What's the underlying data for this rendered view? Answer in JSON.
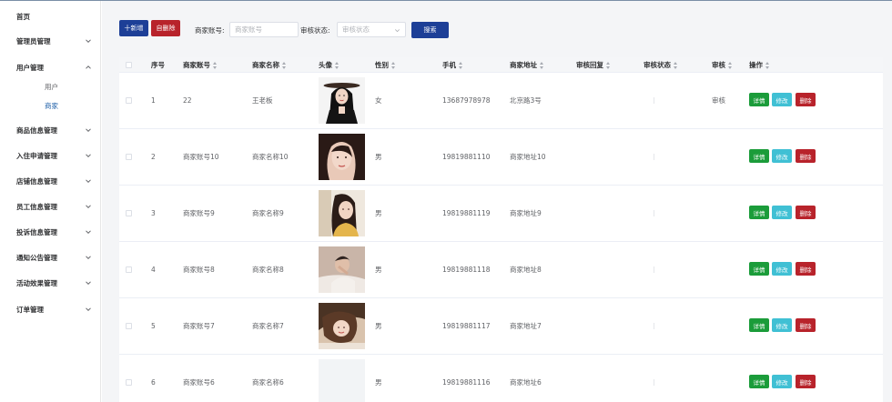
{
  "sidebar": {
    "items": [
      {
        "label": "首页"
      },
      {
        "label": "管理员管理"
      },
      {
        "label": "用户管理"
      },
      {
        "label": "商品信息管理"
      },
      {
        "label": "入住申请管理"
      },
      {
        "label": "店铺信息管理"
      },
      {
        "label": "员工信息管理"
      },
      {
        "label": "投诉信息管理"
      },
      {
        "label": "通知公告管理"
      },
      {
        "label": "活动效果管理"
      },
      {
        "label": "订单管理"
      }
    ],
    "sub_items": [
      {
        "label": "用户"
      },
      {
        "label": "商家"
      }
    ],
    "active_color": "#1f5fa8"
  },
  "toolbar": {
    "add_label": "十新增",
    "delete_label": "自删除",
    "account_label": "商家账号:",
    "account_placeholder": "商家账号",
    "status_label": "审核状态:",
    "status_selected": "审核状态",
    "search_label": "搜索"
  },
  "table": {
    "headers": {
      "index": "序号",
      "account": "商家账号",
      "name": "商家名称",
      "avatar": "头像",
      "gender": "性别",
      "phone": "手机",
      "address": "商家地址",
      "reply": "审核回复",
      "status": "审核状态",
      "audit": "审核",
      "ops": "操作"
    },
    "rows": [
      {
        "index": "1",
        "account": "22",
        "name": "王老板",
        "avatar": "avatar-1",
        "gender": "女",
        "phone": "13687978978",
        "address": "北京路3号",
        "audit": "审核"
      },
      {
        "index": "2",
        "account": "商家账号10",
        "name": "商家名称10",
        "avatar": "avatar-2",
        "gender": "男",
        "phone": "19819881110",
        "address": "商家地址10",
        "audit": ""
      },
      {
        "index": "3",
        "account": "商家账号9",
        "name": "商家名称9",
        "avatar": "avatar-3",
        "gender": "男",
        "phone": "19819881119",
        "address": "商家地址9",
        "audit": ""
      },
      {
        "index": "4",
        "account": "商家账号8",
        "name": "商家名称8",
        "avatar": "avatar-4",
        "gender": "男",
        "phone": "19819881118",
        "address": "商家地址8",
        "audit": ""
      },
      {
        "index": "5",
        "account": "商家账号7",
        "name": "商家名称7",
        "avatar": "avatar-5",
        "gender": "男",
        "phone": "19819881117",
        "address": "商家地址7",
        "audit": ""
      },
      {
        "index": "6",
        "account": "商家账号6",
        "name": "商家名称6",
        "avatar": "avatar-6",
        "gender": "男",
        "phone": "19819881116",
        "address": "商家地址6",
        "audit": ""
      }
    ],
    "ops": {
      "detail": "详情",
      "edit": "修改",
      "delete": "删除"
    }
  },
  "colors": {
    "primary": "#1d3f97",
    "danger": "#b8232b",
    "success": "#1b9c3a",
    "info": "#40c0d4"
  }
}
